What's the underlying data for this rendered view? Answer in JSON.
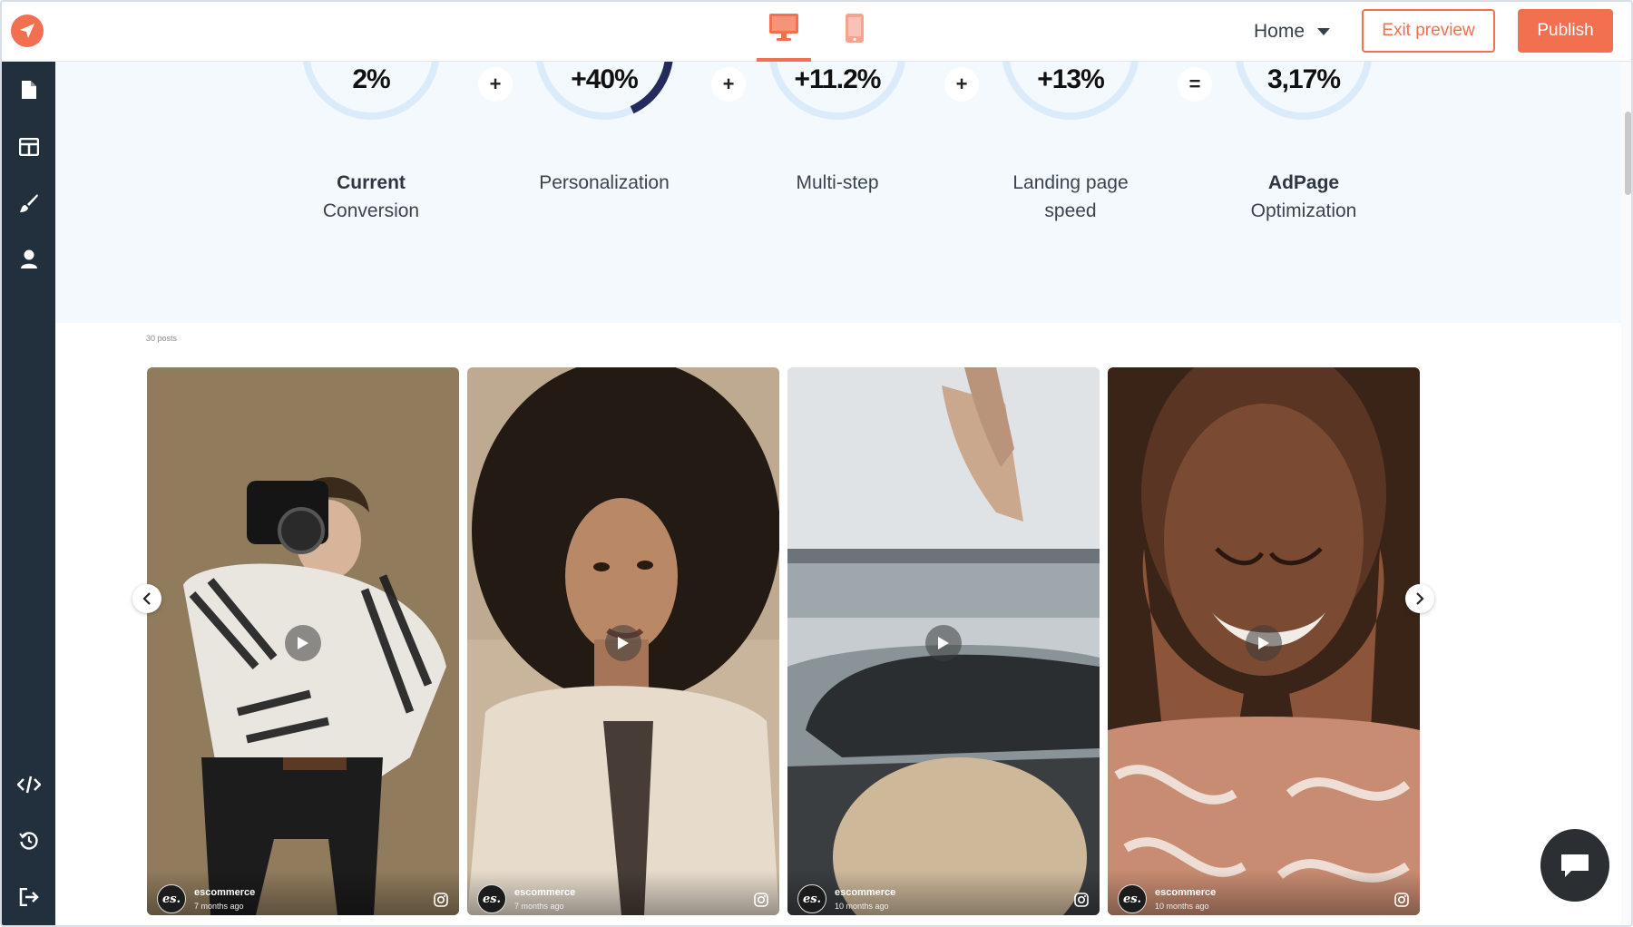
{
  "topbar": {
    "device_desktop": "desktop-icon",
    "device_mobile": "mobile-icon",
    "page_select": "Home",
    "exit_preview_label": "Exit preview",
    "publish_label": "Publish"
  },
  "sidebar": {
    "top_icons": [
      "pages-icon",
      "layout-icon",
      "brush-icon",
      "user-icon"
    ],
    "bottom_icons": [
      "code-icon",
      "history-icon",
      "logout-icon"
    ]
  },
  "stats": {
    "items": [
      {
        "value": "2%",
        "label1": "Current",
        "label2": "Conversion",
        "label1_bold": true,
        "progress": 0
      },
      {
        "value": "+40%",
        "label1": "Personalization",
        "label2": "",
        "label1_bold": false,
        "progress": 0.18
      },
      {
        "value": "+11.2%",
        "label1": "Multi-step",
        "label2": "",
        "label1_bold": false,
        "progress": 0
      },
      {
        "value": "+13%",
        "label1": "Landing page",
        "label2": "speed",
        "label1_bold": false,
        "progress": 0
      },
      {
        "value": "3,17%",
        "label1": "AdPage",
        "label2": "Optimization",
        "label1_bold": true,
        "progress": 0
      }
    ],
    "operators": [
      "+",
      "+",
      "+",
      "="
    ]
  },
  "feed": {
    "caption": "30 posts",
    "posts": [
      {
        "author": "escommerce",
        "ago": "7 months ago",
        "avatar": "es."
      },
      {
        "author": "escommerce",
        "ago": "7 months ago",
        "avatar": "es."
      },
      {
        "author": "escommerce",
        "ago": "10 months ago",
        "avatar": "es."
      },
      {
        "author": "escommerce",
        "ago": "10 months ago",
        "avatar": "es."
      }
    ]
  },
  "colors": {
    "accent": "#f26f4f",
    "sidebar": "#22303d",
    "band": "#f4f9fe",
    "ring_track": "#dcebfa",
    "ring_progress": "#232a5c"
  }
}
